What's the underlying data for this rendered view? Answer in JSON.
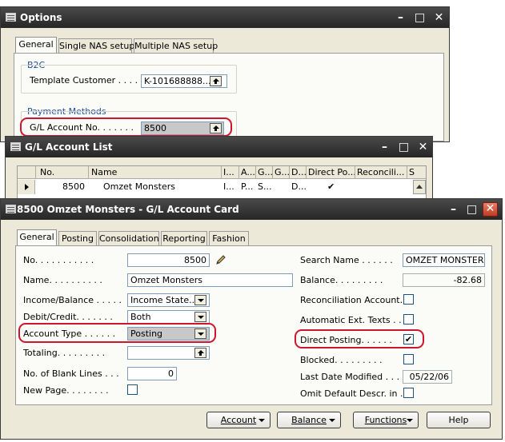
{
  "options": {
    "title": "Options",
    "tabs": [
      "General",
      "Single NAS setup",
      "Multiple NAS setup"
    ],
    "b2c_group": "B2C",
    "template_customer_label": "Template Customer . . . . .",
    "template_customer_value": "K-101688888...",
    "payment_group": "Payment Methods",
    "gl_account_label": "G/L Account No. . . . . . .",
    "gl_account_value": "8500"
  },
  "list": {
    "title": "G/L Account List",
    "columns": [
      "No.",
      "Name",
      "I...",
      "A...",
      "G...",
      "G...",
      "D...",
      "Direct Po...",
      "Reconcili...",
      "S"
    ],
    "row": {
      "no": "8500",
      "name": "Omzet Monsters",
      "c1": "I...",
      "c2": "P...",
      "c3": "S...",
      "c5": "D...",
      "direct": "✔"
    }
  },
  "card": {
    "title": "8500 Omzet Monsters - G/L Account Card",
    "tabs": [
      "General",
      "Posting",
      "Consolidation",
      "Reporting",
      "Fashion"
    ],
    "left": {
      "no_label": "No. . . . . . . . . . .",
      "no_value": "8500",
      "name_label": "Name. . . . . . . . . .",
      "name_value": "Omzet Monsters",
      "income_label": "Income/Balance . . . . .",
      "income_value": "Income State...",
      "debit_label": "Debit/Credit. . . . . . .",
      "debit_value": "Both",
      "type_label": "Account Type . . . . . .",
      "type_value": "Posting",
      "totaling_label": "Totaling. . . . . . . . .",
      "totaling_value": "",
      "blank_label": "No. of Blank Lines . . .",
      "blank_value": "0",
      "newpage_label": "New Page. . . . . . . ."
    },
    "right": {
      "search_label": "Search Name . . . . . .",
      "search_value": "OMZET MONSTERS",
      "balance_label": "Balance. . . . . . . . .",
      "balance_value": "-82.68",
      "recon_label": "Reconciliation Account. .",
      "autotext_label": "Automatic Ext. Texts . . .",
      "direct_label": "Direct Posting. . . . . .",
      "direct_check": "✔",
      "blocked_label": "Blocked. . . . . . . . .",
      "lastmod_label": "Last Date Modified . . .",
      "lastmod_value": "05/22/06",
      "omit_label": "Omit Default Descr. in ..."
    },
    "buttons": {
      "account": "Account",
      "balance": "Balance",
      "functions": "Functions",
      "help": "Help"
    }
  }
}
